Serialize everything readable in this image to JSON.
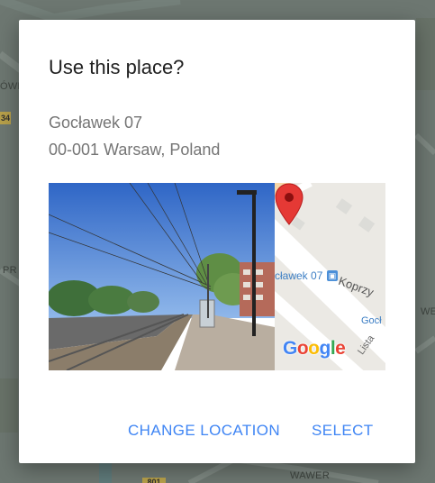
{
  "background": {
    "labels": {
      "wawer": "WAWER",
      "we": "WE",
      "pr": "PR",
      "owe": "ÓWE",
      "shield_left": "34",
      "shield_bottom": "801"
    }
  },
  "dialog": {
    "title": "Use this place?",
    "address_line1": "Gocławek 07",
    "address_line2": "00-001 Warsaw, Poland",
    "map_preview": {
      "stop_label": "cławek 07",
      "stop_icon": "bus-stop-icon",
      "street_1": "Koprzy",
      "street_2": "Gocł",
      "street_3": "Lista",
      "logo_letters": [
        "G",
        "o",
        "o",
        "g",
        "l",
        "e"
      ],
      "logo_colors": [
        "#4285F4",
        "#EA4335",
        "#FBBC05",
        "#4285F4",
        "#34A853",
        "#EA4335"
      ],
      "pin_color": "#E53935"
    },
    "actions": {
      "change_location_label": "CHANGE LOCATION",
      "select_label": "SELECT"
    },
    "accent_color": "#3F85F4"
  }
}
